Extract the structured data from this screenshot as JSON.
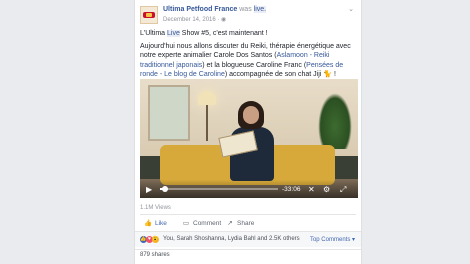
{
  "post": {
    "page_name": "Ultima Petfood France",
    "was_text": "was",
    "live_text": "live.",
    "date": "December 14, 2016 · ",
    "menu_icon": "chevron-down-icon",
    "line1_a": "L'Ultima ",
    "line1_live": "Live",
    "line1_b": " Show #5, c'est maintenant !",
    "para_a": "Aujourd'hui nous allons discuter du Reiki, thérapie énergétique avec notre experte animalier Carole Dos Santos (",
    "para_link1": "Aslamoon - Reiki traditionnel japonais",
    "para_b": ") et la blogueuse Caroline Franc (",
    "para_link2": "Pensées de ronde - Le blog de Caroline",
    "para_c": ") accompagnée de son chat Jiji 🐈 !"
  },
  "video": {
    "time": "-33:06",
    "progress_fraction": 0.04
  },
  "stats": {
    "views": "1.1M Views"
  },
  "actions": {
    "like": "Like",
    "comment": "Comment",
    "share": "Share"
  },
  "reactions": {
    "names": "You, Sarah Shoshanna, Lydia Bahl and 2.5K others",
    "top_comments": "Top Comments ▾"
  },
  "shares": "879 shares",
  "colors": {
    "link": "#365899",
    "brand": "#4267b2",
    "like": "#4267b2",
    "love": "#f25268",
    "wow": "#f7b125"
  }
}
